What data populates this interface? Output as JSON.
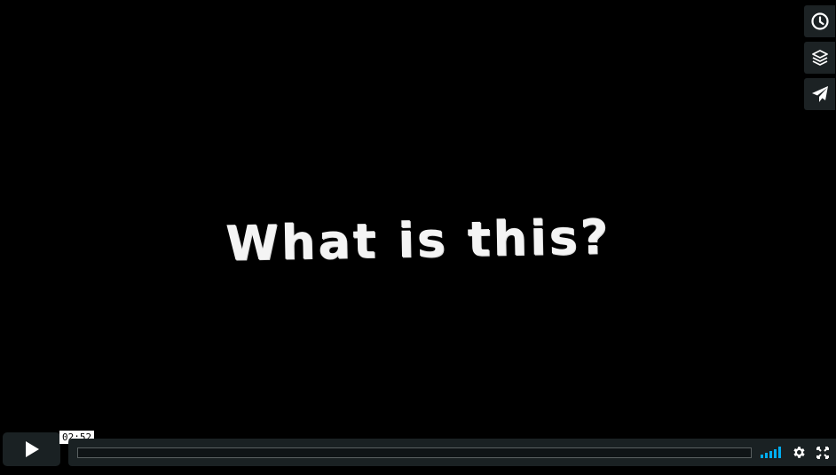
{
  "video": {
    "overlay_text": "What is this?"
  },
  "side_buttons": {
    "watch_later": {
      "icon": "clock-icon"
    },
    "collections": {
      "icon": "layers-icon"
    },
    "share": {
      "icon": "paper-plane-icon"
    }
  },
  "controls": {
    "play_icon": "play-icon",
    "time_tooltip": "02:52",
    "progress": 0,
    "volume_icon": "volume-bars-icon",
    "settings_icon": "gear-icon",
    "fullscreen_icon": "fullscreen-icon",
    "accent_color": "#00adef"
  }
}
